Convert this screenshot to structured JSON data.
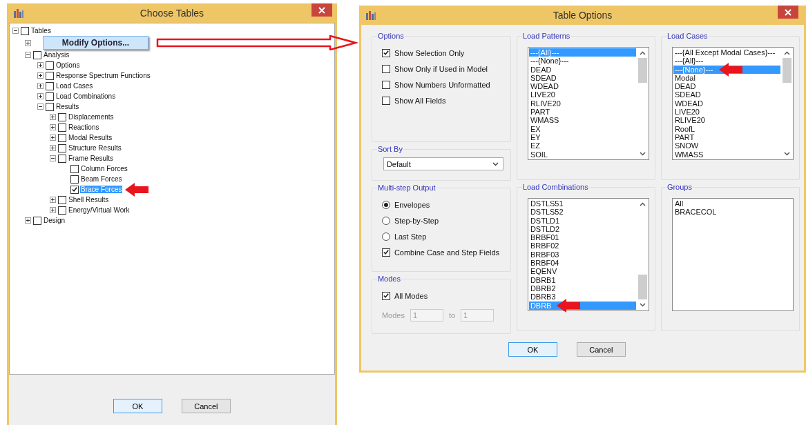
{
  "choose_tables": {
    "title": "Choose Tables",
    "tree": [
      {
        "label": "Tables",
        "expanded": true,
        "checked": false,
        "selected": false,
        "pointer": false,
        "children": [
          {
            "expanded": false
          },
          {
            "label": "Analysis",
            "expanded": true,
            "checked": false,
            "selected": false,
            "pointer": false,
            "children": [
              {
                "label": "Options",
                "expanded": false,
                "checked": false,
                "selected": false,
                "pointer": false
              },
              {
                "label": "Response Spectrum Functions",
                "expanded": false,
                "checked": false,
                "selected": false,
                "pointer": false
              },
              {
                "label": "Load Cases",
                "expanded": false,
                "checked": false,
                "selected": false,
                "pointer": false
              },
              {
                "label": "Load Combinations",
                "expanded": false,
                "checked": false,
                "selected": false,
                "pointer": false
              },
              {
                "label": "Results",
                "expanded": true,
                "checked": false,
                "selected": false,
                "pointer": false,
                "children": [
                  {
                    "label": "Displacements",
                    "expanded": false,
                    "checked": false,
                    "selected": false,
                    "pointer": false
                  },
                  {
                    "label": "Reactions",
                    "expanded": false,
                    "checked": false,
                    "selected": false,
                    "pointer": false
                  },
                  {
                    "label": "Modal Results",
                    "expanded": false,
                    "checked": false,
                    "selected": false,
                    "pointer": false
                  },
                  {
                    "label": "Structure Results",
                    "expanded": false,
                    "checked": false,
                    "selected": false,
                    "pointer": false
                  },
                  {
                    "label": "Frame Results",
                    "expanded": true,
                    "checked": false,
                    "selected": false,
                    "pointer": false,
                    "children": [
                      {
                        "label": "Column Forces",
                        "checked": false,
                        "selected": false,
                        "pointer": false
                      },
                      {
                        "label": "Beam Forces",
                        "checked": false,
                        "selected": false,
                        "pointer": false
                      },
                      {
                        "label": "Brace Forces",
                        "checked": true,
                        "selected": true,
                        "pointer": true
                      }
                    ]
                  },
                  {
                    "label": "Shell Results",
                    "expanded": false,
                    "checked": false,
                    "selected": false,
                    "pointer": false
                  },
                  {
                    "label": "Energy/Virtual Work",
                    "expanded": false,
                    "checked": false,
                    "selected": false,
                    "pointer": false
                  }
                ]
              }
            ]
          },
          {
            "label": "Design",
            "expanded": false,
            "checked": false,
            "selected": false,
            "pointer": false
          }
        ]
      }
    ],
    "context_menu": {
      "item": "Modify Options..."
    },
    "buttons": [
      "OK",
      "Cancel"
    ]
  },
  "table_options": {
    "title": "Table Options",
    "options": {
      "label": "Options",
      "checkboxes": [
        {
          "label": "Show Selection Only",
          "checked": true
        },
        {
          "label": "Show Only if Used in Model",
          "checked": false
        },
        {
          "label": "Show Numbers Unformatted",
          "checked": false
        },
        {
          "label": "Show All Fields",
          "checked": false
        }
      ]
    },
    "sort_by": {
      "label": "Sort By",
      "value": "Default"
    },
    "multi_step_output": {
      "label": "Multi-step Output",
      "radios": [
        {
          "label": "Envelopes",
          "selected": true
        },
        {
          "label": "Step-by-Step",
          "selected": false
        },
        {
          "label": "Last Step",
          "selected": false
        }
      ],
      "checkbox": {
        "label": "Combine Case and Step Fields",
        "checked": true
      }
    },
    "modes": {
      "label": "Modes",
      "checkbox": {
        "label": "All Modes",
        "checked": true
      },
      "range_label": "Modes",
      "from": "1",
      "to_label": "to",
      "to": "1",
      "disabled": true
    },
    "load_patterns": {
      "label": "Load Patterns",
      "items": [
        {
          "text": "---{All}---",
          "selected": true,
          "pointer": false
        },
        {
          "text": "---{None}---",
          "selected": false,
          "pointer": false
        },
        {
          "text": "DEAD",
          "selected": false,
          "pointer": false
        },
        {
          "text": "SDEAD",
          "selected": false,
          "pointer": false
        },
        {
          "text": "WDEAD",
          "selected": false,
          "pointer": false
        },
        {
          "text": "LIVE20",
          "selected": false,
          "pointer": false
        },
        {
          "text": "RLIVE20",
          "selected": false,
          "pointer": false
        },
        {
          "text": "PART",
          "selected": false,
          "pointer": false
        },
        {
          "text": "WMASS",
          "selected": false,
          "pointer": false
        },
        {
          "text": "EX",
          "selected": false,
          "pointer": false
        },
        {
          "text": "EY",
          "selected": false,
          "pointer": false
        },
        {
          "text": "EZ",
          "selected": false,
          "pointer": false
        },
        {
          "text": "SOIL",
          "selected": false,
          "pointer": false
        }
      ]
    },
    "load_cases": {
      "label": "Load Cases",
      "items": [
        {
          "text": "---{All Except Modal Cases}---",
          "selected": false,
          "pointer": false
        },
        {
          "text": "---{All}---",
          "selected": false,
          "pointer": false
        },
        {
          "text": "---{None}---",
          "selected": true,
          "pointer": true
        },
        {
          "text": "Modal",
          "selected": false,
          "pointer": false
        },
        {
          "text": "DEAD",
          "selected": false,
          "pointer": false
        },
        {
          "text": "SDEAD",
          "selected": false,
          "pointer": false
        },
        {
          "text": "WDEAD",
          "selected": false,
          "pointer": false
        },
        {
          "text": "LIVE20",
          "selected": false,
          "pointer": false
        },
        {
          "text": "RLIVE20",
          "selected": false,
          "pointer": false
        },
        {
          "text": "RoofL",
          "selected": false,
          "pointer": false
        },
        {
          "text": "PART",
          "selected": false,
          "pointer": false
        },
        {
          "text": "SNOW",
          "selected": false,
          "pointer": false
        },
        {
          "text": "WMASS",
          "selected": false,
          "pointer": false
        }
      ]
    },
    "load_combinations": {
      "label": "Load Combinations",
      "items": [
        {
          "text": "DSTLS51",
          "selected": false,
          "pointer": false
        },
        {
          "text": "DSTLS52",
          "selected": false,
          "pointer": false
        },
        {
          "text": "DSTLD1",
          "selected": false,
          "pointer": false
        },
        {
          "text": "DSTLD2",
          "selected": false,
          "pointer": false
        },
        {
          "text": "BRBF01",
          "selected": false,
          "pointer": false
        },
        {
          "text": "BRBF02",
          "selected": false,
          "pointer": false
        },
        {
          "text": "BRBF03",
          "selected": false,
          "pointer": false
        },
        {
          "text": "BRBF04",
          "selected": false,
          "pointer": false
        },
        {
          "text": "EQENV",
          "selected": false,
          "pointer": false
        },
        {
          "text": "DBRB1",
          "selected": false,
          "pointer": false
        },
        {
          "text": "DBRB2",
          "selected": false,
          "pointer": false
        },
        {
          "text": "DBRB3",
          "selected": false,
          "pointer": false
        },
        {
          "text": "DBRB",
          "selected": true,
          "pointer": true
        }
      ]
    },
    "groups": {
      "label": "Groups",
      "items": [
        {
          "text": "All",
          "selected": false,
          "pointer": false
        },
        {
          "text": "BRACECOL",
          "selected": false,
          "pointer": false
        }
      ]
    },
    "buttons": [
      "OK",
      "Cancel"
    ]
  }
}
